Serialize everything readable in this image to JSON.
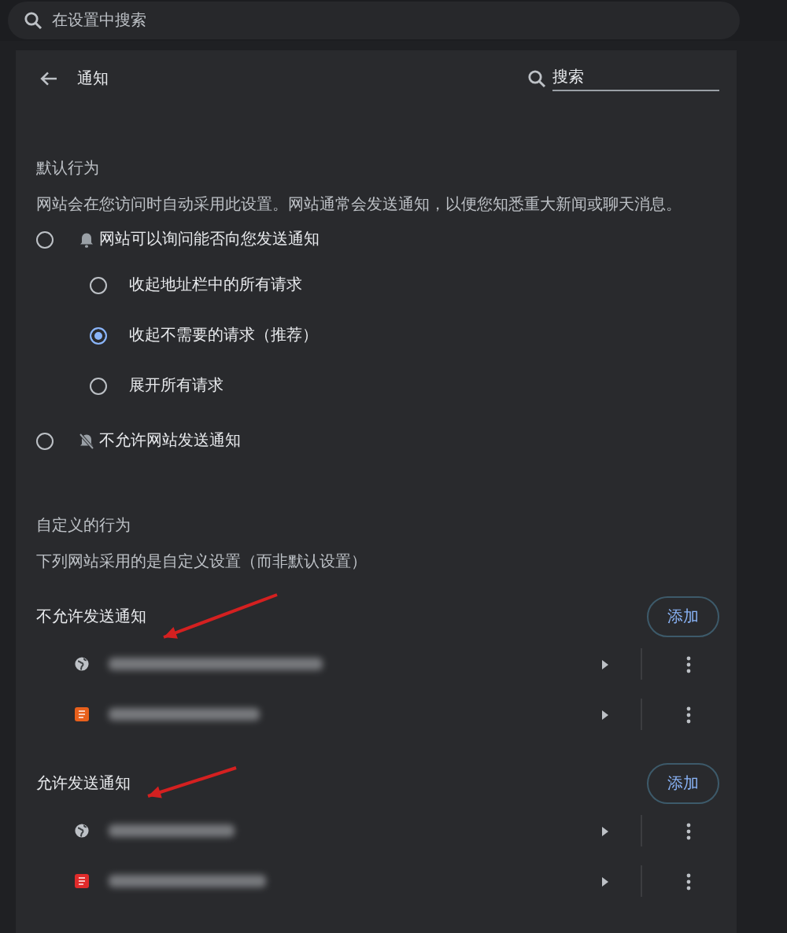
{
  "top_search": {
    "placeholder": "在设置中搜索"
  },
  "header": {
    "title": "通知",
    "search": {
      "placeholder": "搜索"
    }
  },
  "default_behavior": {
    "title": "默认行为",
    "description": "网站会在您访问时自动采用此设置。网站通常会发送通知，以便您知悉重大新闻或聊天消息。",
    "options": [
      {
        "label": "网站可以询问能否向您发送通知",
        "kind": "bell",
        "selected": false,
        "children": [
          {
            "label": "收起地址栏中的所有请求",
            "selected": false
          },
          {
            "label": "收起不需要的请求（推荐）",
            "selected": true
          },
          {
            "label": "展开所有请求",
            "selected": false
          }
        ]
      },
      {
        "label": "不允许网站发送通知",
        "kind": "muted",
        "selected": false
      }
    ]
  },
  "custom_behavior": {
    "title": "自定义的行为",
    "description": "下列网站采用的是自定义设置（而非默认设置）",
    "groups": [
      {
        "title": "不允许发送通知",
        "button": "添加",
        "sites": [
          {
            "kind": "globe",
            "color": "#bdc1c6"
          },
          {
            "kind": "tile",
            "color": "#e8601c"
          }
        ]
      },
      {
        "title": "允许发送通知",
        "button": "添加",
        "sites": [
          {
            "kind": "globe",
            "color": "#bdc1c6"
          },
          {
            "kind": "tile",
            "color": "#e02b2b"
          }
        ]
      }
    ]
  }
}
